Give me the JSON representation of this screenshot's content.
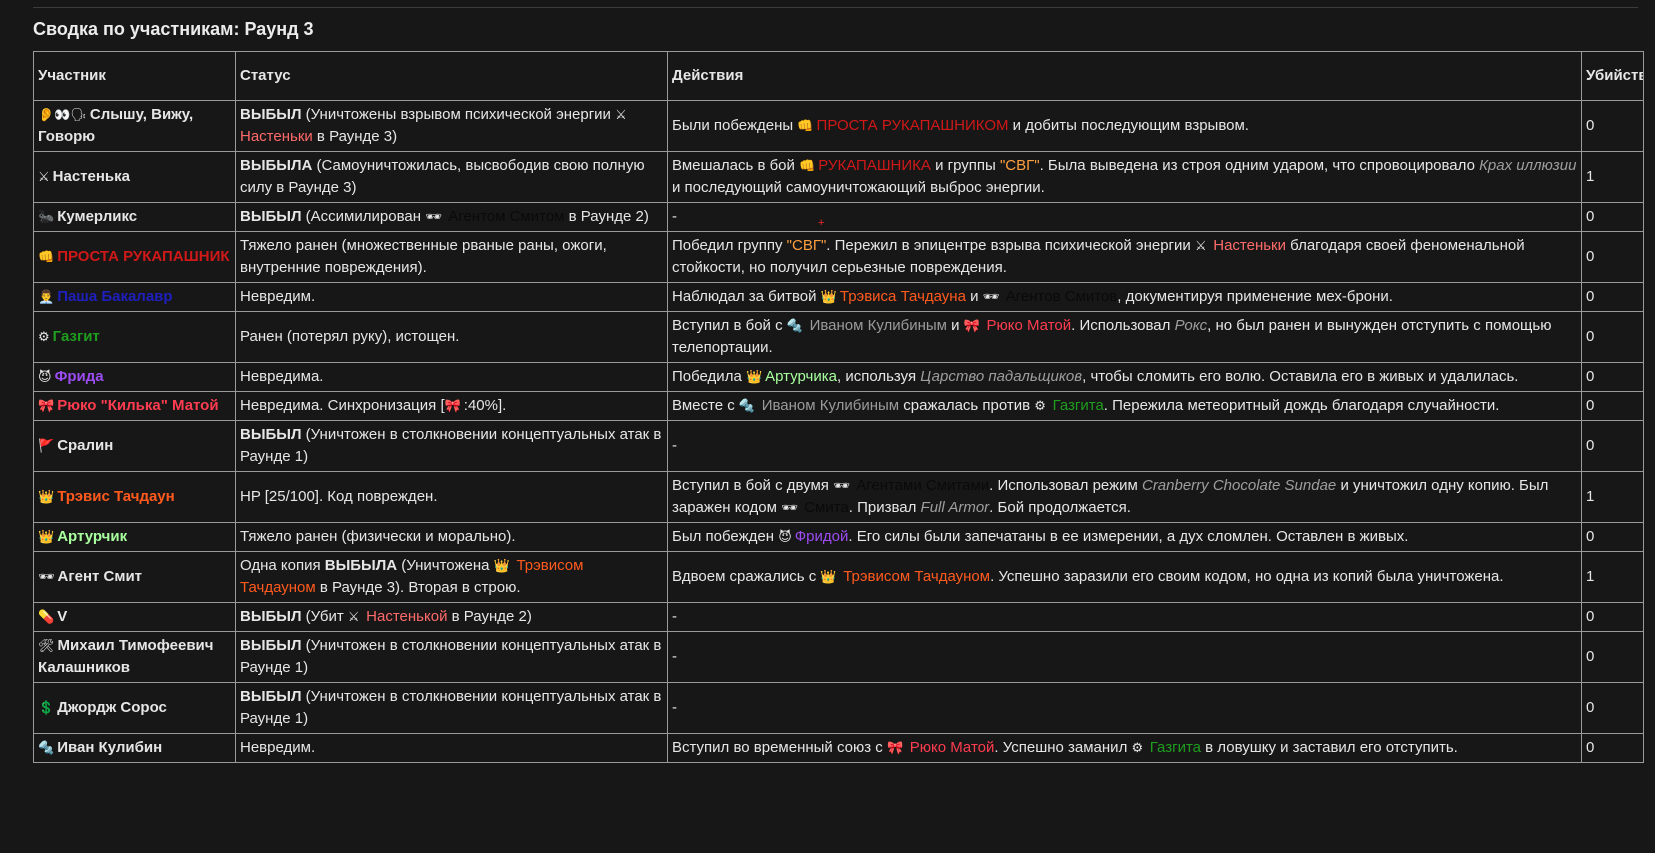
{
  "title": "Сводка по участникам: Раунд 3",
  "headers": {
    "participant": "Участник",
    "status": "Статус",
    "actions": "Действия",
    "kills": "Убийства"
  },
  "marker": "+",
  "rows": [
    {
      "icon": "👂👀🗣",
      "name": "Слышу, Вижу, Говорю",
      "status": [
        {
          "t": "ВЫБЫЛ",
          "c": "b"
        },
        {
          "t": " (Уничтожены взрывом психической энергии "
        },
        {
          "t": "⚔ ",
          "c": "ic"
        },
        {
          "t": "Настеньки",
          "c": "c-salmon"
        },
        {
          "t": " в Раунде 3)"
        }
      ],
      "actions": [
        {
          "t": "Были побеждены "
        },
        {
          "t": "👊",
          "c": "ic"
        },
        {
          "t": "ПРОСТА РУКАПАШНИКОМ",
          "c": "c-red"
        },
        {
          "t": " и добиты последующим взрывом."
        }
      ],
      "kills": "0"
    },
    {
      "icon": "⚔",
      "name": "Настенька",
      "status": [
        {
          "t": "ВЫБЫЛА",
          "c": "b"
        },
        {
          "t": " (Самоуничтожилась, высвободив свою полную силу в Раунде 3)"
        }
      ],
      "actions": [
        {
          "t": "Вмешалась в бой "
        },
        {
          "t": "👊",
          "c": "ic"
        },
        {
          "t": "РУКАПАШНИКА",
          "c": "c-red"
        },
        {
          "t": " и группы "
        },
        {
          "t": "\"СВГ\"",
          "c": "c-gold"
        },
        {
          "t": ". Была выведена из строя одним ударом, что спровоцировало "
        },
        {
          "t": "Крах иллюзии",
          "c": "it"
        },
        {
          "t": " и последующий самоуничтожающий выброс энергии."
        }
      ],
      "kills": "1"
    },
    {
      "icon": "🐜",
      "name": "Кумерликс",
      "status": [
        {
          "t": "ВЫБЫЛ",
          "c": "b"
        },
        {
          "t": " (Ассимилирован "
        },
        {
          "t": "🕶 ",
          "c": "ic"
        },
        {
          "t": "Агентом Смитом",
          "c": "c-black"
        },
        {
          "t": " в Раунде 2)"
        }
      ],
      "actions": [
        {
          "t": "-"
        }
      ],
      "kills": "0"
    },
    {
      "icon": "👊",
      "name": "ПРОСТА РУКАПАШНИК",
      "nc": "c-red",
      "status": [
        {
          "t": "Тяжело ранен (множественные рваные раны, ожоги, внутренние повреждения)."
        }
      ],
      "actions": [
        {
          "t": "Победил группу "
        },
        {
          "t": "\"СВГ\"",
          "c": "c-gold"
        },
        {
          "t": ". Пережил в эпицентре взрыва психической энергии "
        },
        {
          "t": "⚔ ",
          "c": "ic"
        },
        {
          "t": "Настеньки",
          "c": "c-salmon"
        },
        {
          "t": " благодаря своей феноменальной стойкости, но получил серьезные повреждения."
        }
      ],
      "kills": "0"
    },
    {
      "icon": "👨‍💼",
      "name": "Паша Бакалавр",
      "nc": "c-navy",
      "status": [
        {
          "t": "Невредим."
        }
      ],
      "actions": [
        {
          "t": "Наблюдал за битвой "
        },
        {
          "t": "👑",
          "c": "ic"
        },
        {
          "t": "Трэвиса Тачдауна",
          "c": "c-orange"
        },
        {
          "t": " и "
        },
        {
          "t": "🕶 ",
          "c": "ic"
        },
        {
          "t": "Агентов Смитов",
          "c": "c-black"
        },
        {
          "t": ", документируя применение мех-брони."
        }
      ],
      "kills": "0"
    },
    {
      "icon": "⚙",
      "name": "Газгит",
      "nc": "c-green",
      "status": [
        {
          "t": "Ранен (потерял руку), истощен."
        }
      ],
      "actions": [
        {
          "t": "Вступил в бой с "
        },
        {
          "t": "🔩 ",
          "c": "ic"
        },
        {
          "t": "Иваном Кулибиным",
          "c": "c-gray"
        },
        {
          "t": " и "
        },
        {
          "t": "🎀 ",
          "c": "ic"
        },
        {
          "t": "Рюко Матой",
          "c": "c-pink"
        },
        {
          "t": ". Использовал "
        },
        {
          "t": "Рокс",
          "c": "it"
        },
        {
          "t": ", но был ранен и вынужден отступить с помощью телепортации."
        }
      ],
      "kills": "0"
    },
    {
      "icon": "😈",
      "name": "Фрида",
      "nc": "c-purple",
      "status": [
        {
          "t": "Невредима."
        }
      ],
      "actions": [
        {
          "t": "Победила "
        },
        {
          "t": "👑",
          "c": "ic"
        },
        {
          "t": "Артурчика",
          "c": "c-lgreen"
        },
        {
          "t": ", используя "
        },
        {
          "t": "Царство падальщиков",
          "c": "it"
        },
        {
          "t": ", чтобы сломить его волю. Оставила его в живых и удалилась."
        }
      ],
      "kills": "0"
    },
    {
      "icon": "🎀",
      "name": "Рюко \"Килька\" Матой",
      "nc": "c-pink",
      "status": [
        {
          "t": "Невредима. Синхронизация ["
        },
        {
          "t": "🎀",
          "c": "ic"
        },
        {
          "t": ":40%]."
        }
      ],
      "actions": [
        {
          "t": "Вместе с "
        },
        {
          "t": "🔩 ",
          "c": "ic"
        },
        {
          "t": "Иваном Кулибиным",
          "c": "c-gray"
        },
        {
          "t": " сражалась против "
        },
        {
          "t": "⚙ ",
          "c": "ic"
        },
        {
          "t": "Газгита",
          "c": "c-green"
        },
        {
          "t": ". Пережила метеоритный дождь благодаря случайности."
        }
      ],
      "kills": "0"
    },
    {
      "icon": "🚩",
      "name": "Сралин",
      "status": [
        {
          "t": "ВЫБЫЛ",
          "c": "b"
        },
        {
          "t": " (Уничтожен в столкновении концептуальных атак в Раунде 1)"
        }
      ],
      "actions": [
        {
          "t": "-"
        }
      ],
      "kills": "0"
    },
    {
      "icon": "👑",
      "name": "Трэвис Тачдаун",
      "nc": "c-orange",
      "status": [
        {
          "t": "HP [25/100]. Код поврежден."
        }
      ],
      "actions": [
        {
          "t": "Вступил в бой с двумя "
        },
        {
          "t": "🕶 ",
          "c": "ic"
        },
        {
          "t": "Агентами Смитами",
          "c": "c-black"
        },
        {
          "t": ". Использовал режим "
        },
        {
          "t": "Cranberry Chocolate Sundae",
          "c": "it"
        },
        {
          "t": " и уничтожил одну копию. Был заражен кодом "
        },
        {
          "t": "🕶 ",
          "c": "ic"
        },
        {
          "t": "Смита",
          "c": "c-black"
        },
        {
          "t": ". Призвал "
        },
        {
          "t": "Full Armor",
          "c": "it"
        },
        {
          "t": ". Бой продолжается."
        }
      ],
      "kills": "1"
    },
    {
      "icon": "👑",
      "name": "Артурчик",
      "nc": "c-lgreen",
      "status": [
        {
          "t": "Тяжело ранен (физически и морально)."
        }
      ],
      "actions": [
        {
          "t": "Был побежден "
        },
        {
          "t": "😈",
          "c": "ic"
        },
        {
          "t": "Фридой",
          "c": "c-purple"
        },
        {
          "t": ". Его силы были запечатаны в ее измерении, а дух сломлен. Оставлен в живых."
        }
      ],
      "kills": "0"
    },
    {
      "icon": "🕶",
      "name": "Агент Смит",
      "status": [
        {
          "t": "Одна копия "
        },
        {
          "t": "ВЫБЫЛА",
          "c": "b"
        },
        {
          "t": " (Уничтожена "
        },
        {
          "t": "👑 ",
          "c": "ic"
        },
        {
          "t": "Трэвисом Тачдауном",
          "c": "c-orange"
        },
        {
          "t": " в Раунде 3). Вторая в строю."
        }
      ],
      "actions": [
        {
          "t": "Вдвоем сражались с "
        },
        {
          "t": "👑 ",
          "c": "ic"
        },
        {
          "t": "Трэвисом Тачдауном",
          "c": "c-orange"
        },
        {
          "t": ". Успешно заразили его своим кодом, но одна из копий была уничтожена."
        }
      ],
      "kills": "1"
    },
    {
      "icon": "💊",
      "name": "V",
      "status": [
        {
          "t": "ВЫБЫЛ",
          "c": "b"
        },
        {
          "t": " (Убит "
        },
        {
          "t": "⚔ ",
          "c": "ic"
        },
        {
          "t": "Настенькой",
          "c": "c-salmon"
        },
        {
          "t": " в Раунде 2)"
        }
      ],
      "actions": [
        {
          "t": "-"
        }
      ],
      "kills": "0"
    },
    {
      "icon": "🛠",
      "name": "Михаил Тимофеевич Калашников",
      "status": [
        {
          "t": "ВЫБЫЛ",
          "c": "b"
        },
        {
          "t": " (Уничтожен в столкновении концептуальных атак в Раунде 1)"
        }
      ],
      "actions": [
        {
          "t": "-"
        }
      ],
      "kills": "0"
    },
    {
      "icon": "💲",
      "name": "Джордж Сорос",
      "status": [
        {
          "t": "ВЫБЫЛ",
          "c": "b"
        },
        {
          "t": " (Уничтожен в столкновении концептуальных атак в Раунде 1)"
        }
      ],
      "actions": [
        {
          "t": "-"
        }
      ],
      "kills": "0"
    },
    {
      "icon": "🔩",
      "name": "Иван Кулибин",
      "status": [
        {
          "t": "Невредим."
        }
      ],
      "actions": [
        {
          "t": "Вступил во временный союз с "
        },
        {
          "t": "🎀 ",
          "c": "ic"
        },
        {
          "t": "Рюко Матой",
          "c": "c-pink"
        },
        {
          "t": ". Успешно заманил "
        },
        {
          "t": "⚙ ",
          "c": "ic"
        },
        {
          "t": "Газгита",
          "c": "c-green"
        },
        {
          "t": " в ловушку и заставил его отступить."
        }
      ],
      "kills": "0"
    }
  ]
}
